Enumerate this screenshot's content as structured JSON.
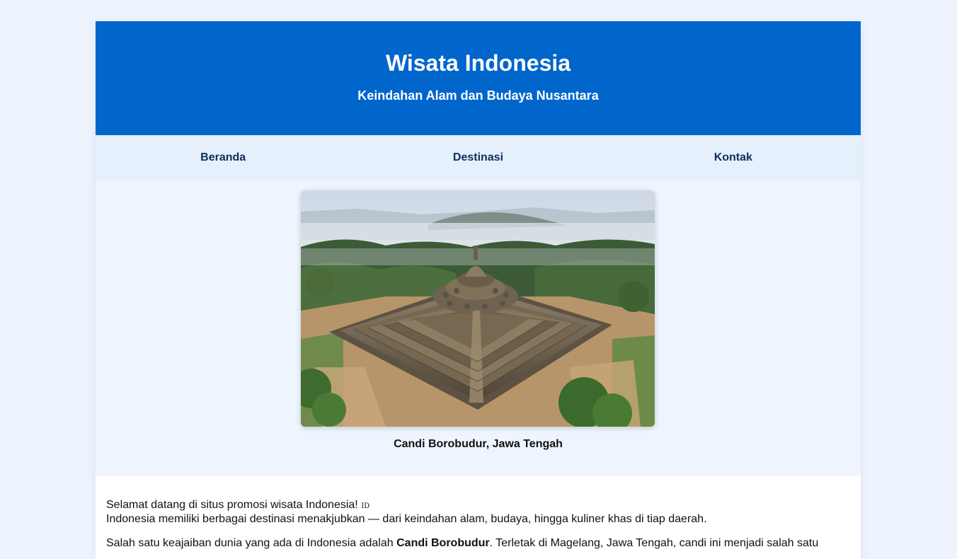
{
  "site": {
    "title": "Wisata Indonesia",
    "subtitle": "Keindahan Alam dan Budaya Nusantara"
  },
  "nav": {
    "items": [
      {
        "label": "Beranda"
      },
      {
        "label": "Destinasi"
      },
      {
        "label": "Kontak"
      }
    ]
  },
  "hero": {
    "image_alt": "Candi Borobudur",
    "caption": "Candi Borobudur, Jawa Tengah"
  },
  "content": {
    "welcome": "Selamat datang di situs promosi wisata Indonesia!",
    "flag_text": "ID",
    "intro": "Indonesia memiliki berbagai destinasi menakjubkan — dari keindahan alam, budaya, hingga kuliner khas di tiap daerah.",
    "para2_start": "Salah satu keajaiban dunia yang ada di Indonesia adalah ",
    "para2_bold": "Candi Borobudur",
    "para2_end": ". Terletak di Magelang, Jawa Tengah, candi ini menjadi salah satu"
  },
  "colors": {
    "header_bg": "#0066cc",
    "nav_bg": "#e6f0fc",
    "nav_text": "#0f2f57",
    "page_bg": "#eef4fd"
  }
}
